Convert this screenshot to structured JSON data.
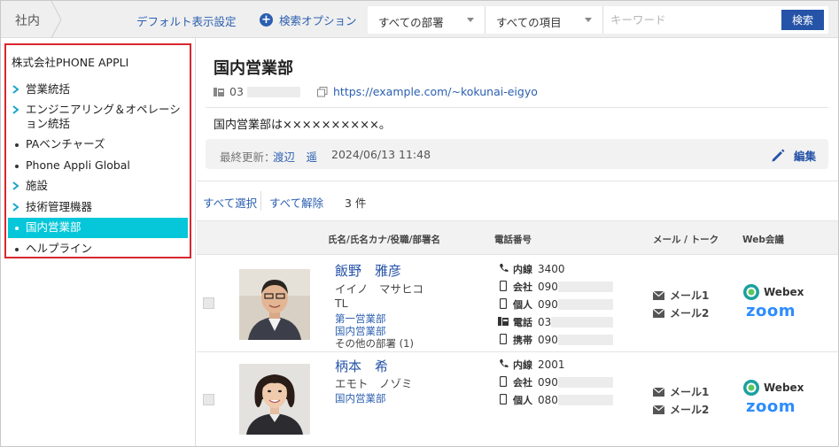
{
  "topbar": {
    "crumb": "社内",
    "default_view_link": "デフォルト表示設定",
    "search_options": "検索オプション",
    "dept_select": "すべての部署",
    "field_select": "すべての項目",
    "keyword_placeholder": "キーワード",
    "search_button": "検索"
  },
  "sidebar": {
    "org_name": "株式会社PHONE APPLI",
    "items": [
      {
        "label": "営業統括",
        "marker": "chevron"
      },
      {
        "label": "エンジニアリング＆オペレーション統括",
        "marker": "chevron"
      },
      {
        "label": "PAベンチャーズ",
        "marker": "dot"
      },
      {
        "label": "Phone Appli Global",
        "marker": "dot"
      },
      {
        "label": "施設",
        "marker": "chevron"
      },
      {
        "label": "技術管理機器",
        "marker": "chevron"
      },
      {
        "label": "国内営業部",
        "marker": "dot",
        "active": true
      },
      {
        "label": "ヘルプライン",
        "marker": "dot"
      }
    ]
  },
  "dept": {
    "title": "国内営業部",
    "phone": "03",
    "url": "https://example.com/~kokunai-eigyo",
    "description": "国内営業部は××××××××××。",
    "updated_label": "最終更新：",
    "updated_by": "渡辺　遥",
    "updated_at": "2024/06/13 11:48",
    "edit_label": "編集"
  },
  "list": {
    "select_all": "すべて選択",
    "deselect_all": "すべて解除",
    "count": "3 件",
    "headers": {
      "name": "氏名/氏名カナ/役職/部署名",
      "phone": "電話番号",
      "mail": "メール / トーク",
      "web": "Web会議"
    }
  },
  "people": [
    {
      "name": "飯野　雅彦",
      "kana": "イイノ　マサヒコ",
      "title": "TL",
      "depts": [
        "第一営業部",
        "国内営業部"
      ],
      "other": "その他の部署 (1)",
      "phones": [
        {
          "icon": "phone-icon",
          "label": "内線",
          "value": "3400"
        },
        {
          "icon": "mobile-icon",
          "label": "会社",
          "value": "090"
        },
        {
          "icon": "mobile-icon",
          "label": "個人",
          "value": "090"
        },
        {
          "icon": "fax-icon",
          "label": "電話",
          "value": "03"
        },
        {
          "icon": "mobile-icon",
          "label": "携帯",
          "value": "090"
        }
      ],
      "mails": [
        "メール1",
        "メール2"
      ],
      "webex": "Webex",
      "zoom": "zoom"
    },
    {
      "name": "柄本　希",
      "kana": "エモト　ノゾミ",
      "title": "",
      "depts": [
        "国内営業部"
      ],
      "other": "",
      "phones": [
        {
          "icon": "phone-icon",
          "label": "内線",
          "value": "2001"
        },
        {
          "icon": "mobile-icon",
          "label": "会社",
          "value": "090"
        },
        {
          "icon": "mobile-icon",
          "label": "個人",
          "value": "080"
        }
      ],
      "mails": [
        "メール1",
        "メール2"
      ],
      "webex": "Webex",
      "zoom": "zoom"
    }
  ],
  "colors": {
    "accent": "#2553a7",
    "link": "#2b5fb0",
    "active_node": "#06c7d9",
    "tree_border": "#d9272e",
    "zoom": "#2d8cff"
  }
}
